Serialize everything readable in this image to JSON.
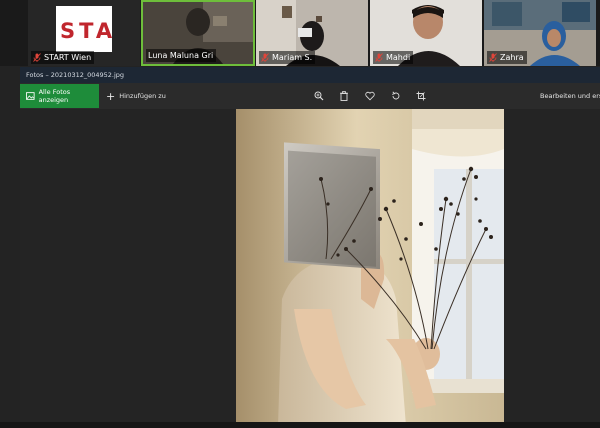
{
  "participants": [
    {
      "name": "START Wien",
      "logo_text": "STA"
    },
    {
      "name": "Luna Maluna Gri"
    },
    {
      "name": "Mariam S."
    },
    {
      "name": "Mahdi"
    },
    {
      "name": "Zahra"
    }
  ],
  "viewer": {
    "title": "Fotos – 20210312_004952.jpg",
    "toolbar": {
      "show_all_label": "Alle Fotos anzeigen",
      "add_label": "Hinzufügen zu",
      "edit_label": "Bearbeiten und ers"
    }
  },
  "colors": {
    "active_speaker": "#6ebe3b",
    "accent_green": "#1e8c3a",
    "mute_red": "#e0453a",
    "logo_red": "#c0262d"
  },
  "icons": [
    "mic-off-icon",
    "image-icon",
    "plus-icon",
    "zoom-icon",
    "trash-icon",
    "heart-icon",
    "rotate-icon",
    "crop-icon",
    "edit-icon"
  ]
}
